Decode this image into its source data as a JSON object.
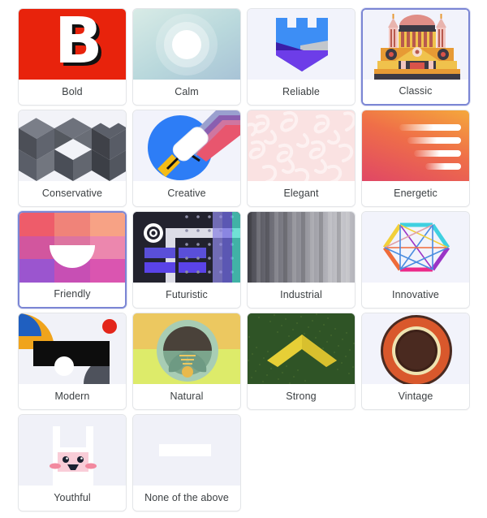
{
  "page": {
    "title": "Brand style selector",
    "selected_border_color": "#7b86d4",
    "card_background": "#ffffff",
    "thumb_background": "#f2f3fb",
    "label_color": "#3c4043",
    "columns": 4,
    "total_options": 18
  },
  "options": [
    {
      "id": "bold",
      "label": "Bold",
      "selected": false,
      "art": "bold-letter-b-illustration",
      "colors": {
        "bg": "#e8230c",
        "fg": "#ffffff",
        "shadow": "#111111"
      }
    },
    {
      "id": "calm",
      "label": "Calm",
      "selected": false,
      "art": "calm-glowing-circle-illustration",
      "colors": {
        "bg": "#b9d8dc",
        "fg": "#ffffff"
      }
    },
    {
      "id": "reliable",
      "label": "Reliable",
      "selected": false,
      "art": "reliable-castle-shield-illustration",
      "colors": {
        "bg": "#f2f3fb",
        "blue": "#3d8ef5",
        "purple": "#6d3de8",
        "indigo": "#3b1ea8",
        "grey": "#c2c6cc"
      }
    },
    {
      "id": "classic",
      "label": "Classic",
      "selected": true,
      "art": "classic-domed-building-illustration",
      "colors": {
        "bg": "#f2f3fb",
        "dome": "#e08e87",
        "body": "#f0c24c",
        "orange": "#e79a34",
        "pillar": "#b85a4e"
      }
    },
    {
      "id": "conservative",
      "label": "Conservative",
      "selected": false,
      "art": "conservative-isometric-cubes-illustration",
      "colors": {
        "bg": "#eceef6",
        "dark": "#4c4f57",
        "mid": "#7a7e88",
        "light": "#f2f3f8"
      }
    },
    {
      "id": "creative",
      "label": "Creative",
      "selected": false,
      "art": "creative-paint-roller-illustration",
      "colors": {
        "bg": "#f2f3fb",
        "circle": "#2d7df6",
        "yellow": "#f5bc16",
        "stripe1": "#8c93c4",
        "stripe2": "#8a5fb0",
        "stripe3": "#d0719c",
        "stripe4": "#e8506a"
      }
    },
    {
      "id": "elegant",
      "label": "Elegant",
      "selected": false,
      "art": "elegant-damask-pattern-illustration",
      "colors": {
        "bg": "#fae2e2",
        "motif": "#fdf1f1"
      }
    },
    {
      "id": "energetic",
      "label": "Energetic",
      "selected": false,
      "art": "energetic-speed-lines-illustration",
      "colors": {
        "from": "#f5a83c",
        "to": "#e04765",
        "lines": "#ffffff"
      }
    },
    {
      "id": "friendly",
      "label": "Friendly",
      "selected": true,
      "art": "friendly-color-grid-bowl-illustration",
      "colors": {
        "c1": "#ee5c6a",
        "c2": "#f08379",
        "c3": "#f7a285",
        "c4": "#d2569e",
        "c5": "#dd74a0",
        "c6": "#ec87ae",
        "c7": "#9b55cf",
        "c8": "#c74fb4",
        "c9": "#da55b0",
        "bowl": "#ffffff"
      }
    },
    {
      "id": "futuristic",
      "label": "Futuristic",
      "selected": false,
      "art": "futuristic-circuit-target-illustration",
      "colors": {
        "bg": "#22222e",
        "violet": "#5a43e8",
        "lavender": "#8c86e2",
        "mint": "#4ce3cf",
        "light": "#dcdce6"
      }
    },
    {
      "id": "industrial",
      "label": "Industrial",
      "selected": false,
      "art": "industrial-brushed-metal-illustration",
      "colors": {
        "from": "#4a4a52",
        "to": "#c6c6cb"
      }
    },
    {
      "id": "innovative",
      "label": "Innovative",
      "selected": false,
      "art": "innovative-hexagon-network-illustration",
      "colors": {
        "bg": "#f2f3fb",
        "cyan": "#3fd0e0",
        "yellow": "#f2d03b",
        "orange": "#ef6b3a",
        "pink": "#ec2a8a",
        "purple": "#9b34c6",
        "blue": "#4a8ce0"
      }
    },
    {
      "id": "modern",
      "label": "Modern",
      "selected": false,
      "art": "modern-abstract-shapes-illustration",
      "colors": {
        "bg": "#f1f2f8",
        "blue": "#1f5fc0",
        "yellow": "#f0a41c",
        "black": "#0d0d0d",
        "red": "#e3261a",
        "grey": "#4e525c",
        "white": "#ffffff"
      }
    },
    {
      "id": "natural",
      "label": "Natural",
      "selected": false,
      "art": "natural-sunrise-leaf-illustration",
      "colors": {
        "sky": "#ecc860",
        "field": "#ddeb6a",
        "green": "#a8cdb4",
        "dark": "#4a423a",
        "leaf": "#6e9a83",
        "sun": "#e8b94c"
      }
    },
    {
      "id": "strong",
      "label": "Strong",
      "selected": false,
      "art": "strong-chevron-illustration",
      "colors": {
        "bg": "#2f5426",
        "chevron": "#e6cf36"
      }
    },
    {
      "id": "vintage",
      "label": "Vintage",
      "selected": false,
      "art": "vintage-concentric-rings-illustration",
      "colors": {
        "bg": "#f2f3fb",
        "outer": "#d9582c",
        "ring": "#efe3b0",
        "inner": "#4a2a20"
      }
    },
    {
      "id": "youthful",
      "label": "Youthful",
      "selected": false,
      "art": "youthful-bunny-face-illustration",
      "colors": {
        "bg": "#f0f1f8",
        "body": "#ffffff",
        "face": "#f9cdd8",
        "eye": "#1a2030",
        "cheek": "#f2899f"
      }
    },
    {
      "id": "none",
      "label": "None of the above",
      "selected": false,
      "art": "blank-placeholder-illustration",
      "colors": {
        "bg": "#f0f1f8",
        "bar": "#ffffff"
      }
    }
  ]
}
